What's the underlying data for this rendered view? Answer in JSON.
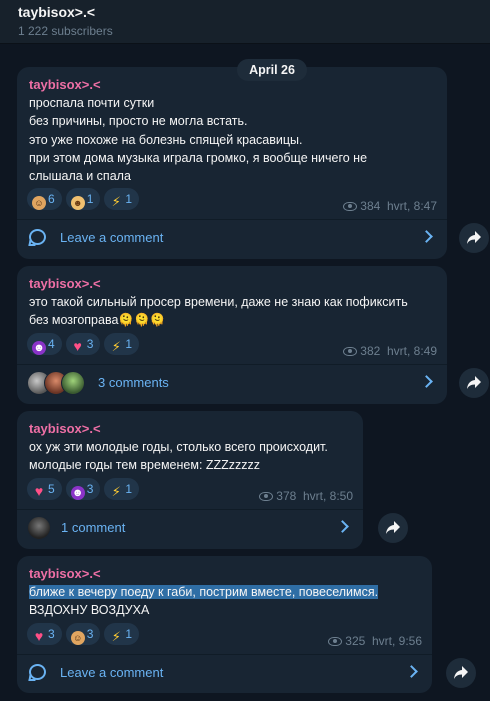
{
  "channel": {
    "title": "taybisox>.<",
    "subscribers": "1 222 subscribers"
  },
  "date_divider": "April 26",
  "messages": [
    {
      "author": "taybisox>.<",
      "text": "проспала почти сутки\nбез причины, просто не могла встать.\nэто уже похоже на болезнь спящей красавицы.\nпри этом дома музыка играла громко, я вообще ничего не\nслышала и спала",
      "reactions": [
        {
          "icon": "face-icon",
          "count": "6"
        },
        {
          "icon": "cowboy-icon",
          "count": "1"
        },
        {
          "icon": "lightning-icon",
          "count": "1"
        }
      ],
      "views": "384",
      "signature": "hvrt, 8:47",
      "comments_label": "Leave a comment"
    },
    {
      "author": "taybisox>.<",
      "text": "это такой сильный просер времени, даже не знаю как пофиксить\nбез мозгоправа",
      "emoji_suffix": "🫠🫠🫠",
      "reactions": [
        {
          "icon": "devil-icon",
          "count": "4"
        },
        {
          "icon": "broken-heart-icon",
          "count": "3"
        },
        {
          "icon": "lightning-icon",
          "count": "1"
        }
      ],
      "views": "382",
      "signature": "hvrt, 8:49",
      "comments_label": "3 comments"
    },
    {
      "author": "taybisox>.<",
      "text": "ох уж эти молодые годы, столько всего происходит.\nмолодые годы тем временем: ZZZzzzzz",
      "reactions": [
        {
          "icon": "broken-heart-icon",
          "count": "5"
        },
        {
          "icon": "devil-icon",
          "count": "3"
        },
        {
          "icon": "lightning-icon",
          "count": "1"
        }
      ],
      "views": "378",
      "signature": "hvrt, 8:50",
      "comments_label": "1 comment"
    },
    {
      "author": "taybisox>.<",
      "text_highlighted": "ближе к вечеру поеду к габи, пострим вместе, повеселимся.",
      "text_rest": "ВЗДОХНУ ВОЗДУХА",
      "reactions": [
        {
          "icon": "broken-heart-icon",
          "count": "3"
        },
        {
          "icon": "face-icon",
          "count": "3"
        },
        {
          "icon": "lightning-icon",
          "count": "1"
        }
      ],
      "views": "325",
      "signature": "hvrt, 9:56",
      "comments_label": "Leave a comment"
    }
  ],
  "colors": {
    "background": "#0e1621",
    "bubble": "#182533",
    "accent": "#6ab3f3",
    "author": "#ee6fa5",
    "meta": "#6d7f8f",
    "highlight": "#2f6ea5"
  }
}
